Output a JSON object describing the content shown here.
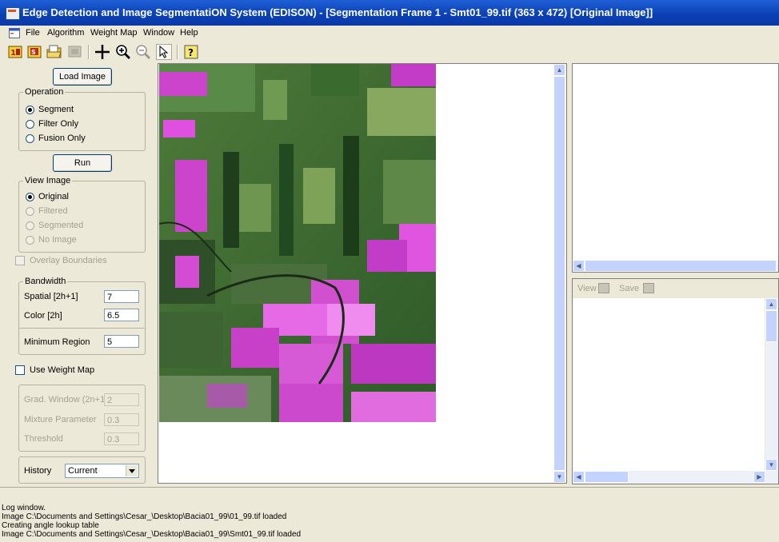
{
  "window": {
    "title": "Edge Detection and Image SegmentatiON System (EDISON) - [Segmentation Frame 1 - Smt01_99.tif (363 x 472) [Original Image]]"
  },
  "menu": {
    "items": [
      "File",
      "Algorithm",
      "Weight Map",
      "Window",
      "Help"
    ]
  },
  "toolbar": {
    "icons": [
      "open-image-icon",
      "save-image-icon",
      "folder-icon",
      "disabled-image-icon",
      "crosshair-icon",
      "zoom-in-icon",
      "zoom-out-icon",
      "pointer-icon",
      "help-icon"
    ]
  },
  "left_panel": {
    "load_button": "Load Image",
    "operation": {
      "legend": "Operation",
      "options": [
        "Segment",
        "Filter Only",
        "Fusion Only"
      ],
      "selected": "Segment"
    },
    "run_button": "Run",
    "view_image": {
      "legend": "View Image",
      "options": [
        "Original",
        "Filtered",
        "Segmented",
        "No Image"
      ],
      "selected": "Original"
    },
    "overlay_boundaries": "Overlay Boundaries",
    "bandwidth": {
      "legend": "Bandwidth",
      "spatial_label": "Spatial [2h+1]",
      "spatial_value": "7",
      "color_label": "Color [2h]",
      "color_value": "6.5",
      "min_region_label": "Minimum Region",
      "min_region_value": "5"
    },
    "use_weight_map": "Use Weight Map",
    "weight_params": {
      "grad_window_label": "Grad. Window (2n+1)",
      "grad_window_value": "2",
      "mixture_label": "Mixture Parameter",
      "mixture_value": "0.3",
      "threshold_label": "Threshold",
      "threshold_value": "0.3"
    },
    "history": {
      "label": "History",
      "value": "Current"
    }
  },
  "right_panel": {
    "view_label": "View",
    "save_label": "Save"
  },
  "log": {
    "lines": [
      "Log window.",
      "Image C:\\Documents and Settings\\Cesar_\\Desktop\\Bacia01_99\\01_99.tif loaded",
      "Creating angle lookup table",
      "Image C:\\Documents and Settings\\Cesar_\\Desktop\\Bacia01_99\\Smt01_99.tif loaded"
    ]
  },
  "colors": {
    "title_bar": "#0a3fb4",
    "chrome": "#ece9d8",
    "image_magenta": "#d633d6",
    "image_green": "#2f5a25"
  }
}
